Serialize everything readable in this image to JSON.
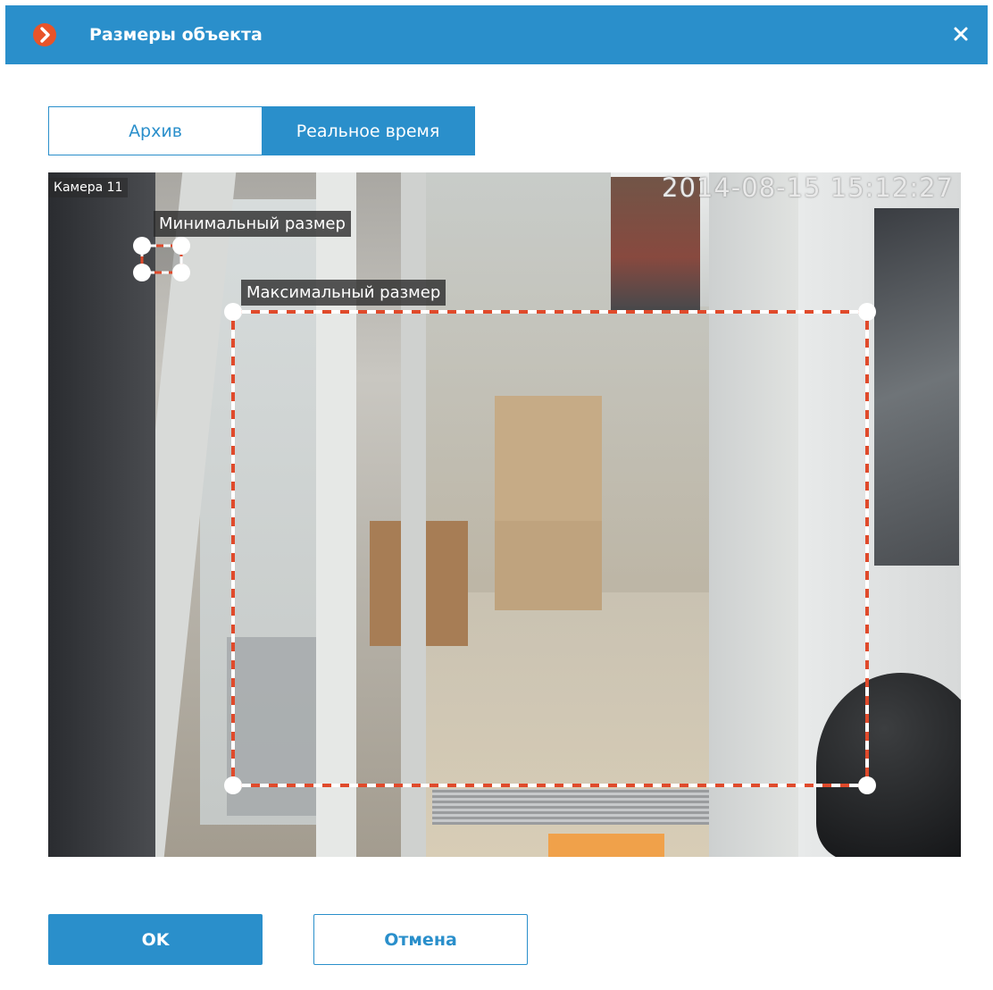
{
  "dialog": {
    "title": "Размеры объекта",
    "logo_icon": "chevron-right-icon",
    "close_icon": "close-icon",
    "accent_color": "#2a8fcb",
    "logo_color": "#e8542a"
  },
  "mode_tabs": [
    {
      "label": "Архив",
      "active": false
    },
    {
      "label": "Реальное время",
      "active": true
    }
  ],
  "video": {
    "camera_name": "Камера 11",
    "timestamp": "2014-08-15 15:12:27",
    "min_size_label": "Минимальный размер",
    "max_size_label": "Максимальный размер",
    "roi_colors": {
      "primary": "#e04a2b",
      "secondary": "#ffffff"
    }
  },
  "buttons": {
    "ok_label": "OK",
    "cancel_label": "Отмена"
  }
}
